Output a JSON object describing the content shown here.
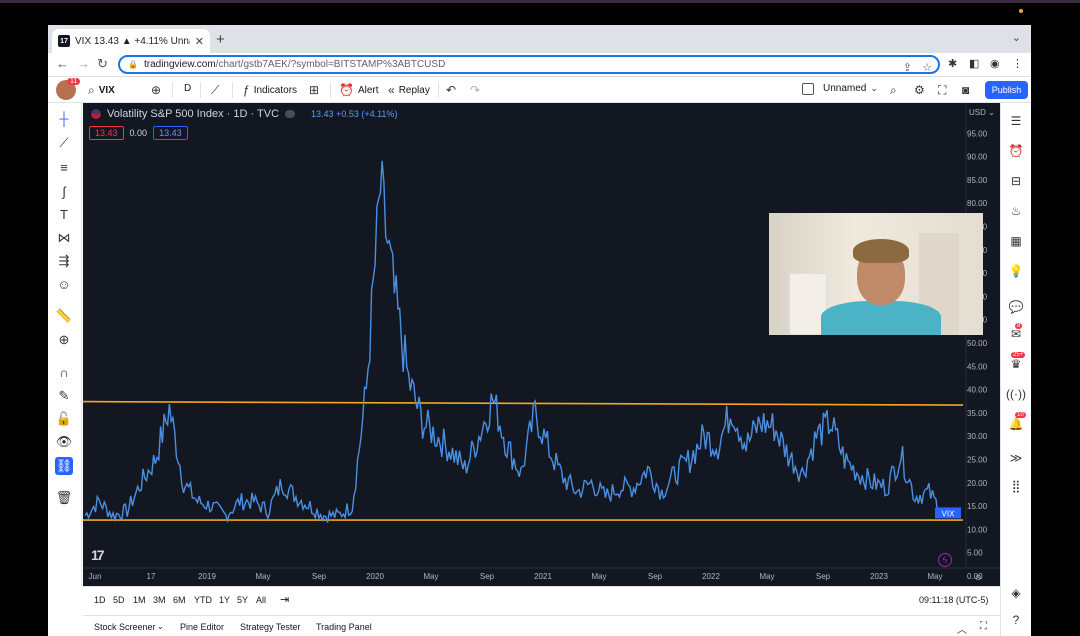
{
  "browser": {
    "tab_title": "VIX 13.43 ▲ +4.11% Unnamed",
    "url_host": "tradingview.com",
    "url_path": "/chart/gstb7AEK/?symbol=BITSTAMP%3ABTCUSD"
  },
  "toolbar": {
    "avatar_badge": "11",
    "symbol": "VIX",
    "interval": "D",
    "indicators": "Indicators",
    "alert": "Alert",
    "replay": "Replay",
    "layout_name": "Unnamed",
    "publish": "Publish"
  },
  "legend": {
    "title": "Volatility S&P 500 Index · 1D · TVC",
    "last": "13.43",
    "change": "+0.53 (+4.11%)",
    "sell": "13.43",
    "spread": "0.00",
    "buy": "13.43"
  },
  "price_axis": {
    "currency": "USD",
    "last_label": "VIX"
  },
  "chart_data": {
    "type": "line",
    "series": [
      {
        "name": "VIX",
        "x": [
          "2018-06",
          "2018-07",
          "2018-08",
          "2018-09",
          "2018-10",
          "2018-11",
          "2018-12",
          "2019-01",
          "2019-02",
          "2019-03",
          "2019-04",
          "2019-05",
          "2019-06",
          "2019-07",
          "2019-08",
          "2019-09",
          "2019-10",
          "2019-11",
          "2019-12",
          "2020-01",
          "2020-02",
          "2020-03",
          "2020-03b",
          "2020-04",
          "2020-05",
          "2020-06",
          "2020-07",
          "2020-08",
          "2020-09",
          "2020-10",
          "2020-11",
          "2020-12",
          "2021-01",
          "2021-02",
          "2021-03",
          "2021-04",
          "2021-05",
          "2021-06",
          "2021-07",
          "2021-08",
          "2021-09",
          "2021-10",
          "2021-11",
          "2021-12",
          "2022-01",
          "2022-02",
          "2022-03",
          "2022-04",
          "2022-05",
          "2022-06",
          "2022-07",
          "2022-08",
          "2022-09",
          "2022-10",
          "2022-11",
          "2022-12",
          "2023-01",
          "2023-02",
          "2023-03",
          "2023-04",
          "2023-05",
          "2023-06"
        ],
        "y": [
          13,
          16,
          13,
          14,
          20,
          25,
          36,
          20,
          16,
          15,
          13,
          16,
          16,
          14,
          20,
          17,
          15,
          13,
          13,
          15,
          40,
          83,
          60,
          42,
          33,
          30,
          27,
          23,
          30,
          38,
          28,
          22,
          35,
          27,
          21,
          18,
          20,
          17,
          19,
          19,
          23,
          18,
          22,
          25,
          30,
          28,
          36,
          28,
          33,
          32,
          26,
          22,
          30,
          33,
          25,
          22,
          20,
          19,
          26,
          17,
          18,
          13.43
        ]
      }
    ],
    "horizontal_lines": [
      37,
      12
    ],
    "y_ticks": [
      "95.00",
      "90.00",
      "85.00",
      "80.00",
      "75.00",
      "70.00",
      "65.00",
      "60.00",
      "55.00",
      "50.00",
      "45.00",
      "40.00",
      "35.00",
      "30.00",
      "25.00",
      "20.00",
      "15.00",
      "10.00",
      "5.00",
      "0.00"
    ],
    "x_ticks": [
      "Jun",
      "17",
      "2019",
      "May",
      "Sep",
      "2020",
      "May",
      "Sep",
      "2021",
      "May",
      "Sep",
      "2022",
      "May",
      "Sep",
      "2023",
      "May"
    ],
    "ylim": [
      0,
      97
    ],
    "colors": {
      "line": "#4a90e2",
      "hline": "#f5a623",
      "background": "#131722"
    }
  },
  "ranges": [
    "1D",
    "5D",
    "1M",
    "3M",
    "6M",
    "YTD",
    "1Y",
    "5Y",
    "All"
  ],
  "clock": "09:11:18 (UTC-5)",
  "panels": [
    "Stock Screener",
    "Pine Editor",
    "Strategy Tester",
    "Trading Panel"
  ],
  "right_badges": {
    "ideas": "8",
    "streams": "25+",
    "alerts": "10"
  }
}
